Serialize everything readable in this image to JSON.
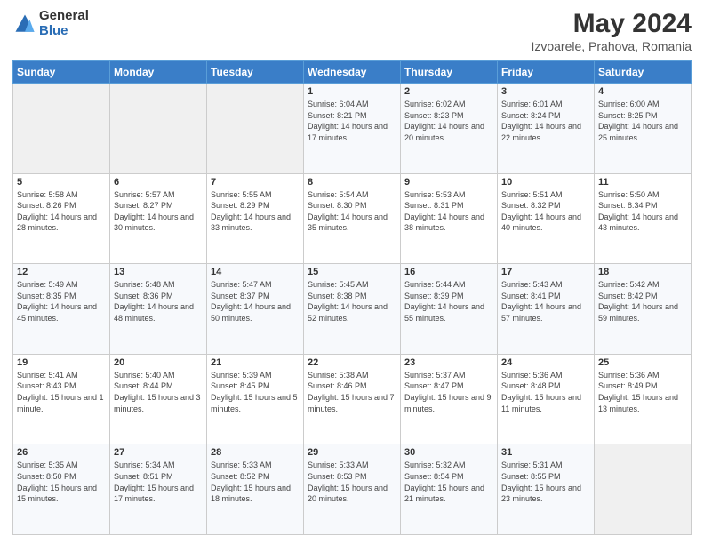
{
  "header": {
    "logo_general": "General",
    "logo_blue": "Blue",
    "title": "May 2024",
    "subtitle": "Izvoarele, Prahova, Romania"
  },
  "days_of_week": [
    "Sunday",
    "Monday",
    "Tuesday",
    "Wednesday",
    "Thursday",
    "Friday",
    "Saturday"
  ],
  "weeks": [
    [
      {
        "day": "",
        "info": ""
      },
      {
        "day": "",
        "info": ""
      },
      {
        "day": "",
        "info": ""
      },
      {
        "day": "1",
        "info": "Sunrise: 6:04 AM\nSunset: 8:21 PM\nDaylight: 14 hours\nand 17 minutes."
      },
      {
        "day": "2",
        "info": "Sunrise: 6:02 AM\nSunset: 8:23 PM\nDaylight: 14 hours\nand 20 minutes."
      },
      {
        "day": "3",
        "info": "Sunrise: 6:01 AM\nSunset: 8:24 PM\nDaylight: 14 hours\nand 22 minutes."
      },
      {
        "day": "4",
        "info": "Sunrise: 6:00 AM\nSunset: 8:25 PM\nDaylight: 14 hours\nand 25 minutes."
      }
    ],
    [
      {
        "day": "5",
        "info": "Sunrise: 5:58 AM\nSunset: 8:26 PM\nDaylight: 14 hours\nand 28 minutes."
      },
      {
        "day": "6",
        "info": "Sunrise: 5:57 AM\nSunset: 8:27 PM\nDaylight: 14 hours\nand 30 minutes."
      },
      {
        "day": "7",
        "info": "Sunrise: 5:55 AM\nSunset: 8:29 PM\nDaylight: 14 hours\nand 33 minutes."
      },
      {
        "day": "8",
        "info": "Sunrise: 5:54 AM\nSunset: 8:30 PM\nDaylight: 14 hours\nand 35 minutes."
      },
      {
        "day": "9",
        "info": "Sunrise: 5:53 AM\nSunset: 8:31 PM\nDaylight: 14 hours\nand 38 minutes."
      },
      {
        "day": "10",
        "info": "Sunrise: 5:51 AM\nSunset: 8:32 PM\nDaylight: 14 hours\nand 40 minutes."
      },
      {
        "day": "11",
        "info": "Sunrise: 5:50 AM\nSunset: 8:34 PM\nDaylight: 14 hours\nand 43 minutes."
      }
    ],
    [
      {
        "day": "12",
        "info": "Sunrise: 5:49 AM\nSunset: 8:35 PM\nDaylight: 14 hours\nand 45 minutes."
      },
      {
        "day": "13",
        "info": "Sunrise: 5:48 AM\nSunset: 8:36 PM\nDaylight: 14 hours\nand 48 minutes."
      },
      {
        "day": "14",
        "info": "Sunrise: 5:47 AM\nSunset: 8:37 PM\nDaylight: 14 hours\nand 50 minutes."
      },
      {
        "day": "15",
        "info": "Sunrise: 5:45 AM\nSunset: 8:38 PM\nDaylight: 14 hours\nand 52 minutes."
      },
      {
        "day": "16",
        "info": "Sunrise: 5:44 AM\nSunset: 8:39 PM\nDaylight: 14 hours\nand 55 minutes."
      },
      {
        "day": "17",
        "info": "Sunrise: 5:43 AM\nSunset: 8:41 PM\nDaylight: 14 hours\nand 57 minutes."
      },
      {
        "day": "18",
        "info": "Sunrise: 5:42 AM\nSunset: 8:42 PM\nDaylight: 14 hours\nand 59 minutes."
      }
    ],
    [
      {
        "day": "19",
        "info": "Sunrise: 5:41 AM\nSunset: 8:43 PM\nDaylight: 15 hours\nand 1 minute."
      },
      {
        "day": "20",
        "info": "Sunrise: 5:40 AM\nSunset: 8:44 PM\nDaylight: 15 hours\nand 3 minutes."
      },
      {
        "day": "21",
        "info": "Sunrise: 5:39 AM\nSunset: 8:45 PM\nDaylight: 15 hours\nand 5 minutes."
      },
      {
        "day": "22",
        "info": "Sunrise: 5:38 AM\nSunset: 8:46 PM\nDaylight: 15 hours\nand 7 minutes."
      },
      {
        "day": "23",
        "info": "Sunrise: 5:37 AM\nSunset: 8:47 PM\nDaylight: 15 hours\nand 9 minutes."
      },
      {
        "day": "24",
        "info": "Sunrise: 5:36 AM\nSunset: 8:48 PM\nDaylight: 15 hours\nand 11 minutes."
      },
      {
        "day": "25",
        "info": "Sunrise: 5:36 AM\nSunset: 8:49 PM\nDaylight: 15 hours\nand 13 minutes."
      }
    ],
    [
      {
        "day": "26",
        "info": "Sunrise: 5:35 AM\nSunset: 8:50 PM\nDaylight: 15 hours\nand 15 minutes."
      },
      {
        "day": "27",
        "info": "Sunrise: 5:34 AM\nSunset: 8:51 PM\nDaylight: 15 hours\nand 17 minutes."
      },
      {
        "day": "28",
        "info": "Sunrise: 5:33 AM\nSunset: 8:52 PM\nDaylight: 15 hours\nand 18 minutes."
      },
      {
        "day": "29",
        "info": "Sunrise: 5:33 AM\nSunset: 8:53 PM\nDaylight: 15 hours\nand 20 minutes."
      },
      {
        "day": "30",
        "info": "Sunrise: 5:32 AM\nSunset: 8:54 PM\nDaylight: 15 hours\nand 21 minutes."
      },
      {
        "day": "31",
        "info": "Sunrise: 5:31 AM\nSunset: 8:55 PM\nDaylight: 15 hours\nand 23 minutes."
      },
      {
        "day": "",
        "info": ""
      }
    ]
  ]
}
